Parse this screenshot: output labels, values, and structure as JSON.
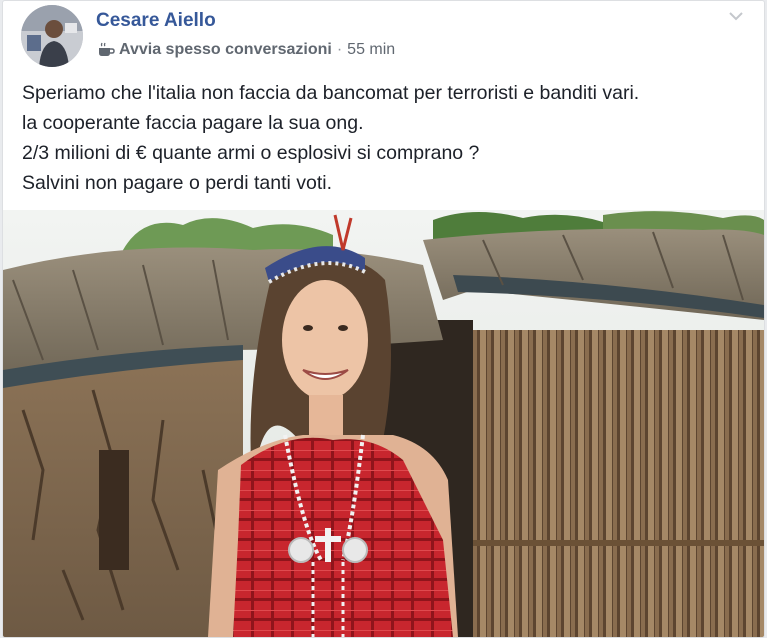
{
  "post": {
    "author": "Cesare Aiello",
    "badge_icon": "coffee-cup-icon",
    "badge": "Avvia spesso conversazioni",
    "separator": "·",
    "time": "55 min",
    "text_lines": [
      "Speriamo che l'italia non faccia da bancomat per terroristi e banditi vari.",
      "la cooperante faccia pagare la sua ong.",
      "2/3 milioni di € quante armi o esplosivi si comprano ?",
      "Salvini non pagare o perdi tanti voti."
    ]
  },
  "colors": {
    "author": "#365899",
    "meta": "#606770",
    "text": "#1d2129",
    "card": "#ffffff",
    "background": "#e9ebee"
  }
}
